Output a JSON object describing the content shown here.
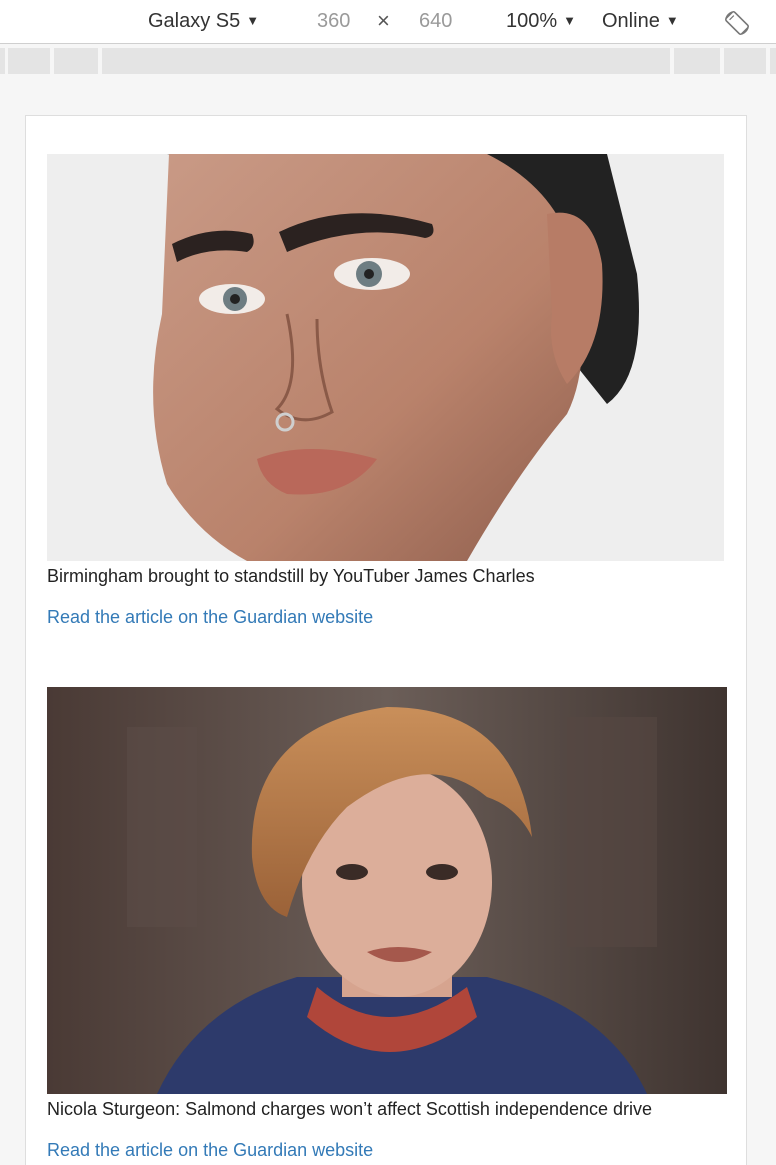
{
  "devtools": {
    "device": "Galaxy S5",
    "width": "360",
    "times": "×",
    "height": "640",
    "zoom": "100%",
    "network": "Online",
    "caret": "▼"
  },
  "articles": [
    {
      "caption": "Birmingham brought to standstill by YouTuber James Charles",
      "link": "Read the article on the Guardian website"
    },
    {
      "caption": "Nicola Sturgeon: Salmond charges won’t affect Scottish independence drive",
      "link": "Read the article on the Guardian website"
    }
  ],
  "colors": {
    "link": "#337ab7",
    "text": "#222222"
  }
}
